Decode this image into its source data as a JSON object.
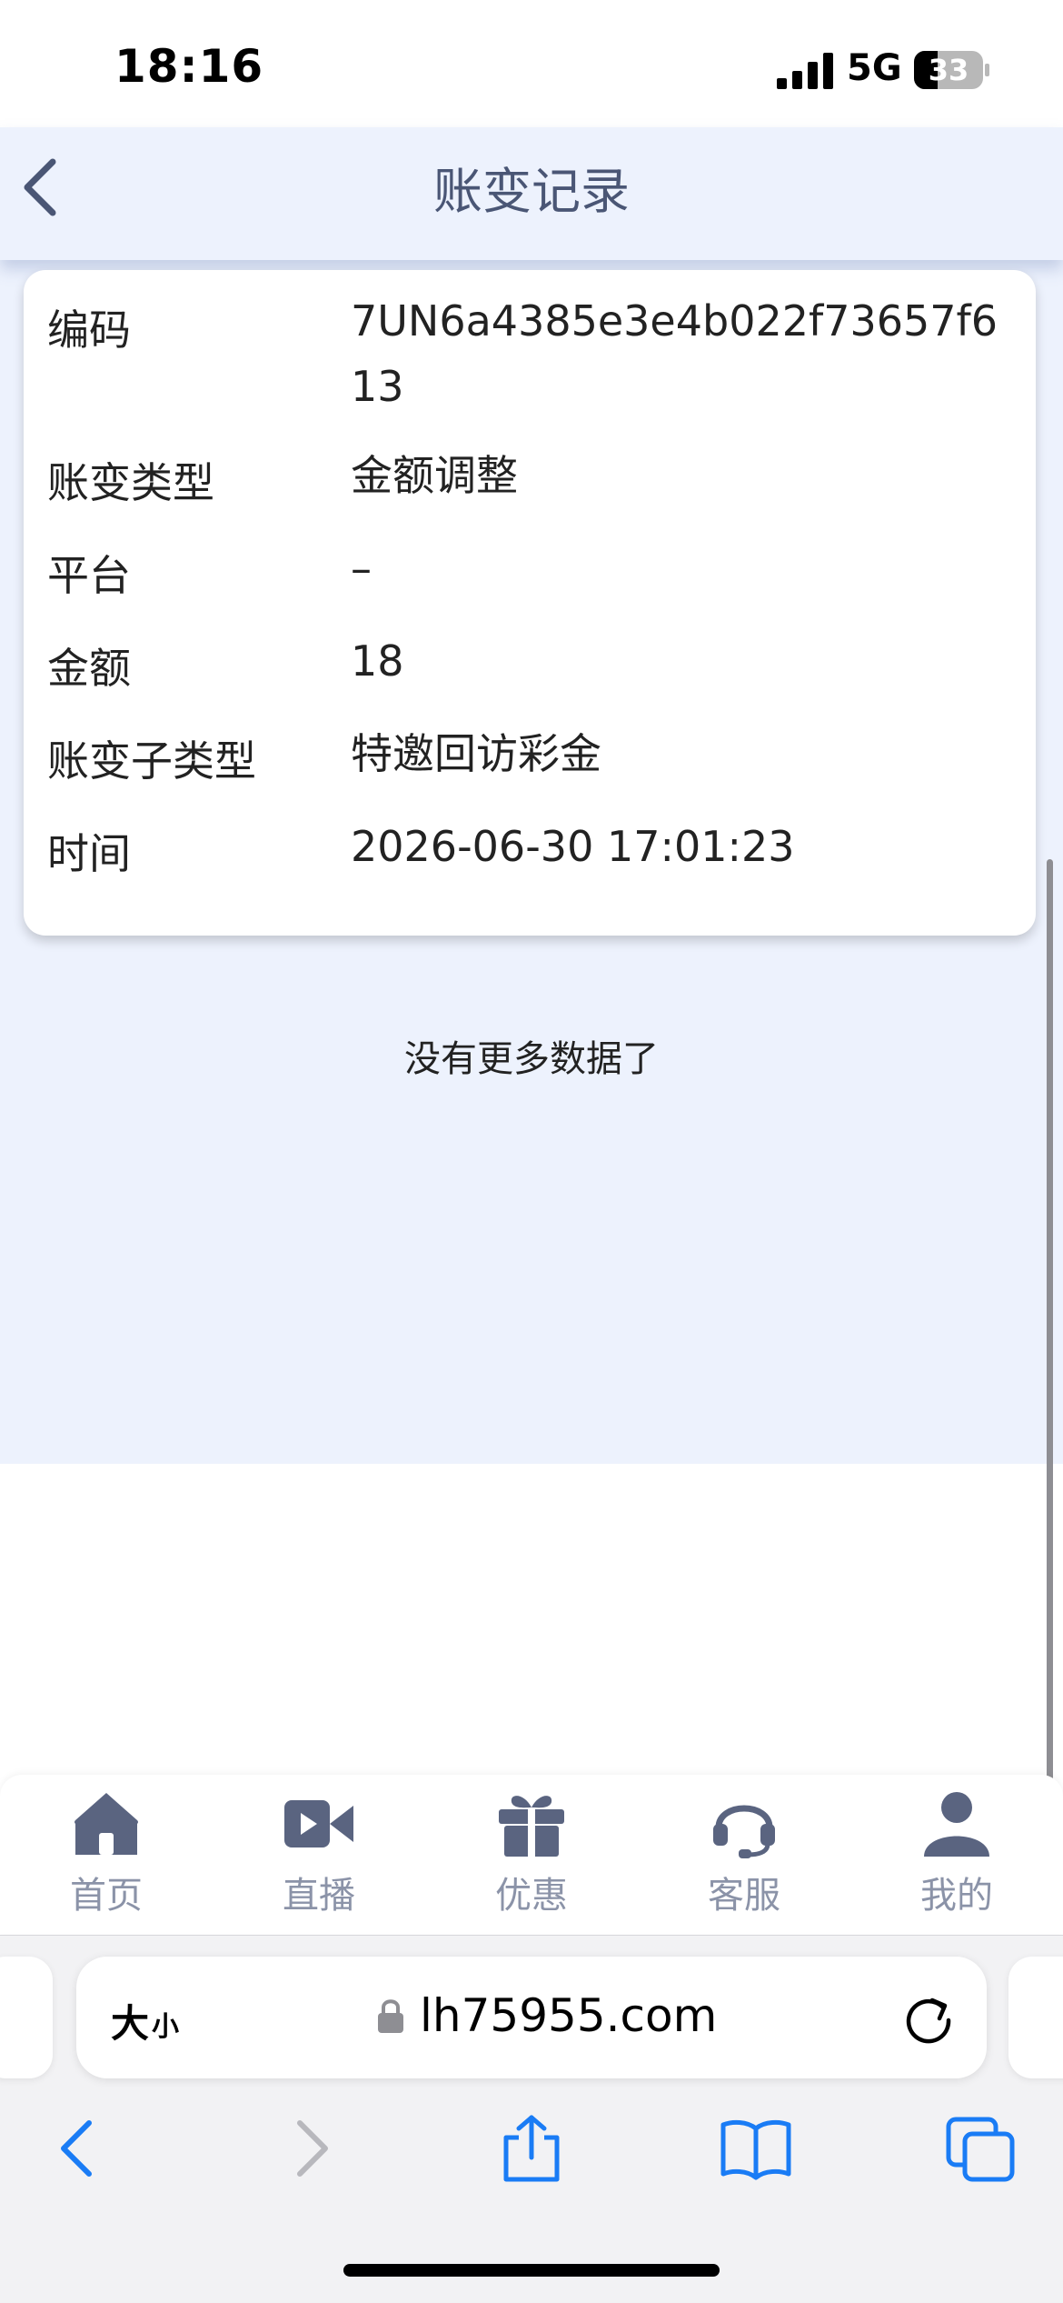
{
  "status_bar": {
    "time": "18:16",
    "network": "5G",
    "battery": "33"
  },
  "header": {
    "title": "账变记录"
  },
  "record": {
    "fields": [
      {
        "label": "编码",
        "value": "7UN6a4385e3e4b022f73657f613"
      },
      {
        "label": "账变类型",
        "value": "金额调整"
      },
      {
        "label": "平台",
        "value": "–"
      },
      {
        "label": "金额",
        "value": "18"
      },
      {
        "label": "账变子类型",
        "value": "特邀回访彩金"
      },
      {
        "label": "时间",
        "value": "2026-06-30 17:01:23"
      }
    ]
  },
  "list_end_text": "没有更多数据了",
  "tab_bar": {
    "tabs": [
      {
        "label": "首页",
        "icon": "home-icon"
      },
      {
        "label": "直播",
        "icon": "video-icon"
      },
      {
        "label": "优惠",
        "icon": "gift-icon"
      },
      {
        "label": "客服",
        "icon": "headset-icon"
      },
      {
        "label": "我的",
        "icon": "user-icon"
      }
    ]
  },
  "browser": {
    "text_size_big": "大",
    "text_size_small": "小",
    "url": "lh75955.com"
  },
  "colors": {
    "page_bg": "#edf2fd",
    "title": "#4a5675",
    "tab_icon": "#5a6480",
    "tab_label": "#8b93a8",
    "ios_blue": "#1a7cf5"
  }
}
